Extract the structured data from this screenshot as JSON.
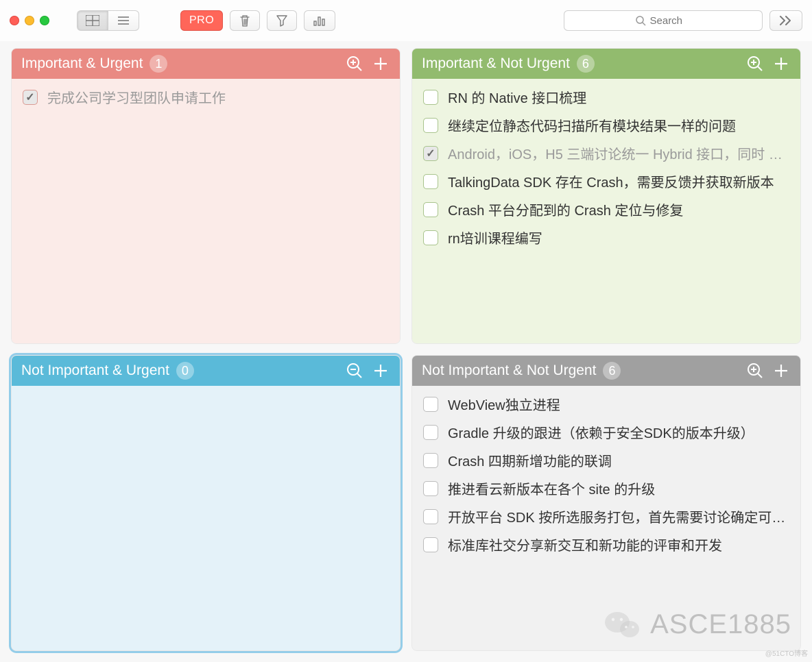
{
  "toolbar": {
    "pro_label": "PRO",
    "search_placeholder": "Search"
  },
  "quadrants": [
    {
      "id": "q1",
      "title": "Important & Urgent",
      "count": 1,
      "zoom": "plus",
      "selected": false,
      "tasks": [
        {
          "done": true,
          "text": "完成公司学习型团队申请工作"
        }
      ]
    },
    {
      "id": "q2",
      "title": "Important & Not Urgent",
      "count": 6,
      "zoom": "plus",
      "selected": false,
      "tasks": [
        {
          "done": false,
          "text": "RN 的 Native 接口梳理"
        },
        {
          "done": false,
          "text": "继续定位静态代码扫描所有模块结果一样的问题"
        },
        {
          "done": true,
          "text": "Android，iOS，H5 三端讨论统一 Hybrid 接口，同时 H..."
        },
        {
          "done": false,
          "text": "TalkingData SDK 存在 Crash，需要反馈并获取新版本"
        },
        {
          "done": false,
          "text": "Crash 平台分配到的 Crash 定位与修复"
        },
        {
          "done": false,
          "text": "rn培训课程编写"
        }
      ]
    },
    {
      "id": "q3",
      "title": "Not Important & Urgent",
      "count": 0,
      "zoom": "minus",
      "selected": true,
      "tasks": []
    },
    {
      "id": "q4",
      "title": "Not Important & Not Urgent",
      "count": 6,
      "zoom": "plus",
      "selected": false,
      "tasks": [
        {
          "done": false,
          "text": "WebView独立进程"
        },
        {
          "done": false,
          "text": "Gradle 升级的跟进（依赖于安全SDK的版本升级）"
        },
        {
          "done": false,
          "text": "Crash 四期新增功能的联调"
        },
        {
          "done": false,
          "text": "推进看云新版本在各个 site 的升级"
        },
        {
          "done": false,
          "text": "开放平台 SDK 按所选服务打包，首先需要讨论确定可以..."
        },
        {
          "done": false,
          "text": "标准库社交分享新交互和新功能的评审和开发"
        }
      ]
    }
  ],
  "watermark": {
    "text": "ASCE1885"
  },
  "corner_watermark": "@51CTO博客"
}
